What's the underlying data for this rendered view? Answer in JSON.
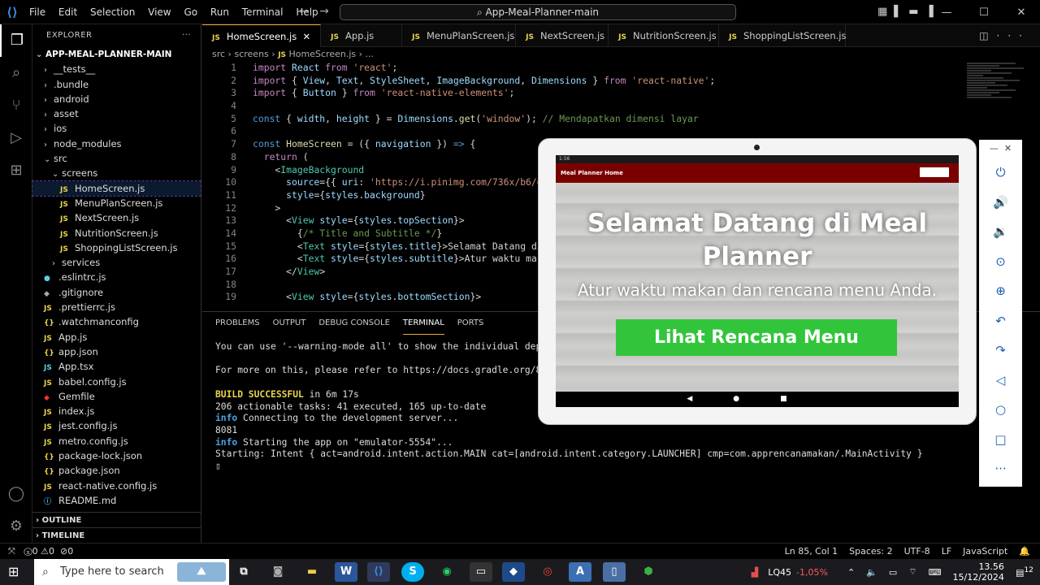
{
  "app": {
    "search_title": "App-Meal-Planner-main"
  },
  "menu": [
    "File",
    "Edit",
    "Selection",
    "View",
    "Go",
    "Run",
    "Terminal",
    "Help"
  ],
  "explorer": {
    "title": "EXPLORER",
    "root": "APP-MEAL-PLANNER-MAIN",
    "items": [
      {
        "label": "__tests__",
        "type": "folder",
        "depth": 1
      },
      {
        "label": ".bundle",
        "type": "folder",
        "depth": 1
      },
      {
        "label": "android",
        "type": "folder",
        "depth": 1
      },
      {
        "label": "asset",
        "type": "folder",
        "depth": 1
      },
      {
        "label": "ios",
        "type": "folder",
        "depth": 1
      },
      {
        "label": "node_modules",
        "type": "folder",
        "depth": 1
      },
      {
        "label": "src",
        "type": "folder-open",
        "depth": 1
      },
      {
        "label": "screens",
        "type": "folder-open",
        "depth": 2
      },
      {
        "label": "HomeScreen.js",
        "type": "js",
        "depth": 3,
        "selected": true
      },
      {
        "label": "MenuPlanScreen.js",
        "type": "js",
        "depth": 3
      },
      {
        "label": "NextScreen.js",
        "type": "js",
        "depth": 3
      },
      {
        "label": "NutritionScreen.js",
        "type": "js",
        "depth": 3
      },
      {
        "label": "ShoppingListScreen.js",
        "type": "js",
        "depth": 3
      },
      {
        "label": "services",
        "type": "folder",
        "depth": 2
      },
      {
        "label": ".eslintrc.js",
        "type": "eslint",
        "depth": 1
      },
      {
        "label": ".gitignore",
        "type": "dot",
        "depth": 1
      },
      {
        "label": ".prettierrc.js",
        "type": "js",
        "depth": 1
      },
      {
        "label": ".watchmanconfig",
        "type": "json",
        "depth": 1
      },
      {
        "label": "App.js",
        "type": "js",
        "depth": 1
      },
      {
        "label": "app.json",
        "type": "json",
        "depth": 1
      },
      {
        "label": "App.tsx",
        "type": "react",
        "depth": 1
      },
      {
        "label": "babel.config.js",
        "type": "js",
        "depth": 1
      },
      {
        "label": "Gemfile",
        "type": "ruby",
        "depth": 1
      },
      {
        "label": "index.js",
        "type": "js",
        "depth": 1
      },
      {
        "label": "jest.config.js",
        "type": "js",
        "depth": 1
      },
      {
        "label": "metro.config.js",
        "type": "js",
        "depth": 1
      },
      {
        "label": "package-lock.json",
        "type": "json",
        "depth": 1
      },
      {
        "label": "package.json",
        "type": "json",
        "depth": 1
      },
      {
        "label": "react-native.config.js",
        "type": "js",
        "depth": 1
      },
      {
        "label": "README.md",
        "type": "info",
        "depth": 1
      }
    ],
    "outline": "OUTLINE",
    "timeline": "TIMELINE"
  },
  "tabs": [
    "HomeScreen.js",
    "App.js",
    "MenuPlanScreen.js",
    "NextScreen.js",
    "NutritionScreen.js",
    "ShoppingListScreen.js"
  ],
  "breadcrumb": {
    "a": "src",
    "b": "screens",
    "c": "HomeScreen.js",
    "d": "..."
  },
  "panel": {
    "tabs": [
      "PROBLEMS",
      "OUTPUT",
      "DEBUG CONSOLE",
      "TERMINAL",
      "PORTS"
    ],
    "lines": {
      "l1": "You can use '--warning-mode all' to show the individual deprecatio",
      "l2": "For more on this, please refer to https://docs.gradle.org/8.10.2/u",
      "l3a": "BUILD SUCCESSFUL",
      "l3b": " in 6m 17s",
      "l4": "206 actionable tasks: 41 executed, 165 up-to-date",
      "l5a": "info",
      "l5b": " Connecting to the development server...",
      "l6": "8081",
      "l7a": "info",
      "l7b": " Starting the app on \"emulator-5554\"...",
      "l8": "Starting: Intent { act=android.intent.action.MAIN cat=[android.intent.category.LAUNCHER] cmp=com.apprencanamakan/.MainActivity }"
    }
  },
  "status": {
    "left_errors": "0",
    "left_warnings": "0",
    "ports": "0",
    "pos": "Ln 85, Col 1",
    "spaces": "Spaces: 2",
    "enc": "UTF-8",
    "eol": "LF",
    "lang": "JavaScript"
  },
  "phone": {
    "appbar_title": "Meal Planner Home",
    "heading": "Selamat Datang di Meal Planner",
    "subtitle": "Atur waktu makan dan rencana menu Anda.",
    "button": "Lihat Rencana Menu",
    "time": "1:56"
  },
  "taskbar": {
    "search_placeholder": "Type here to search",
    "stock": "LQ45",
    "stock_change": "-1,05%",
    "time": "13.56",
    "date": "15/12/2024",
    "notif": "12"
  }
}
